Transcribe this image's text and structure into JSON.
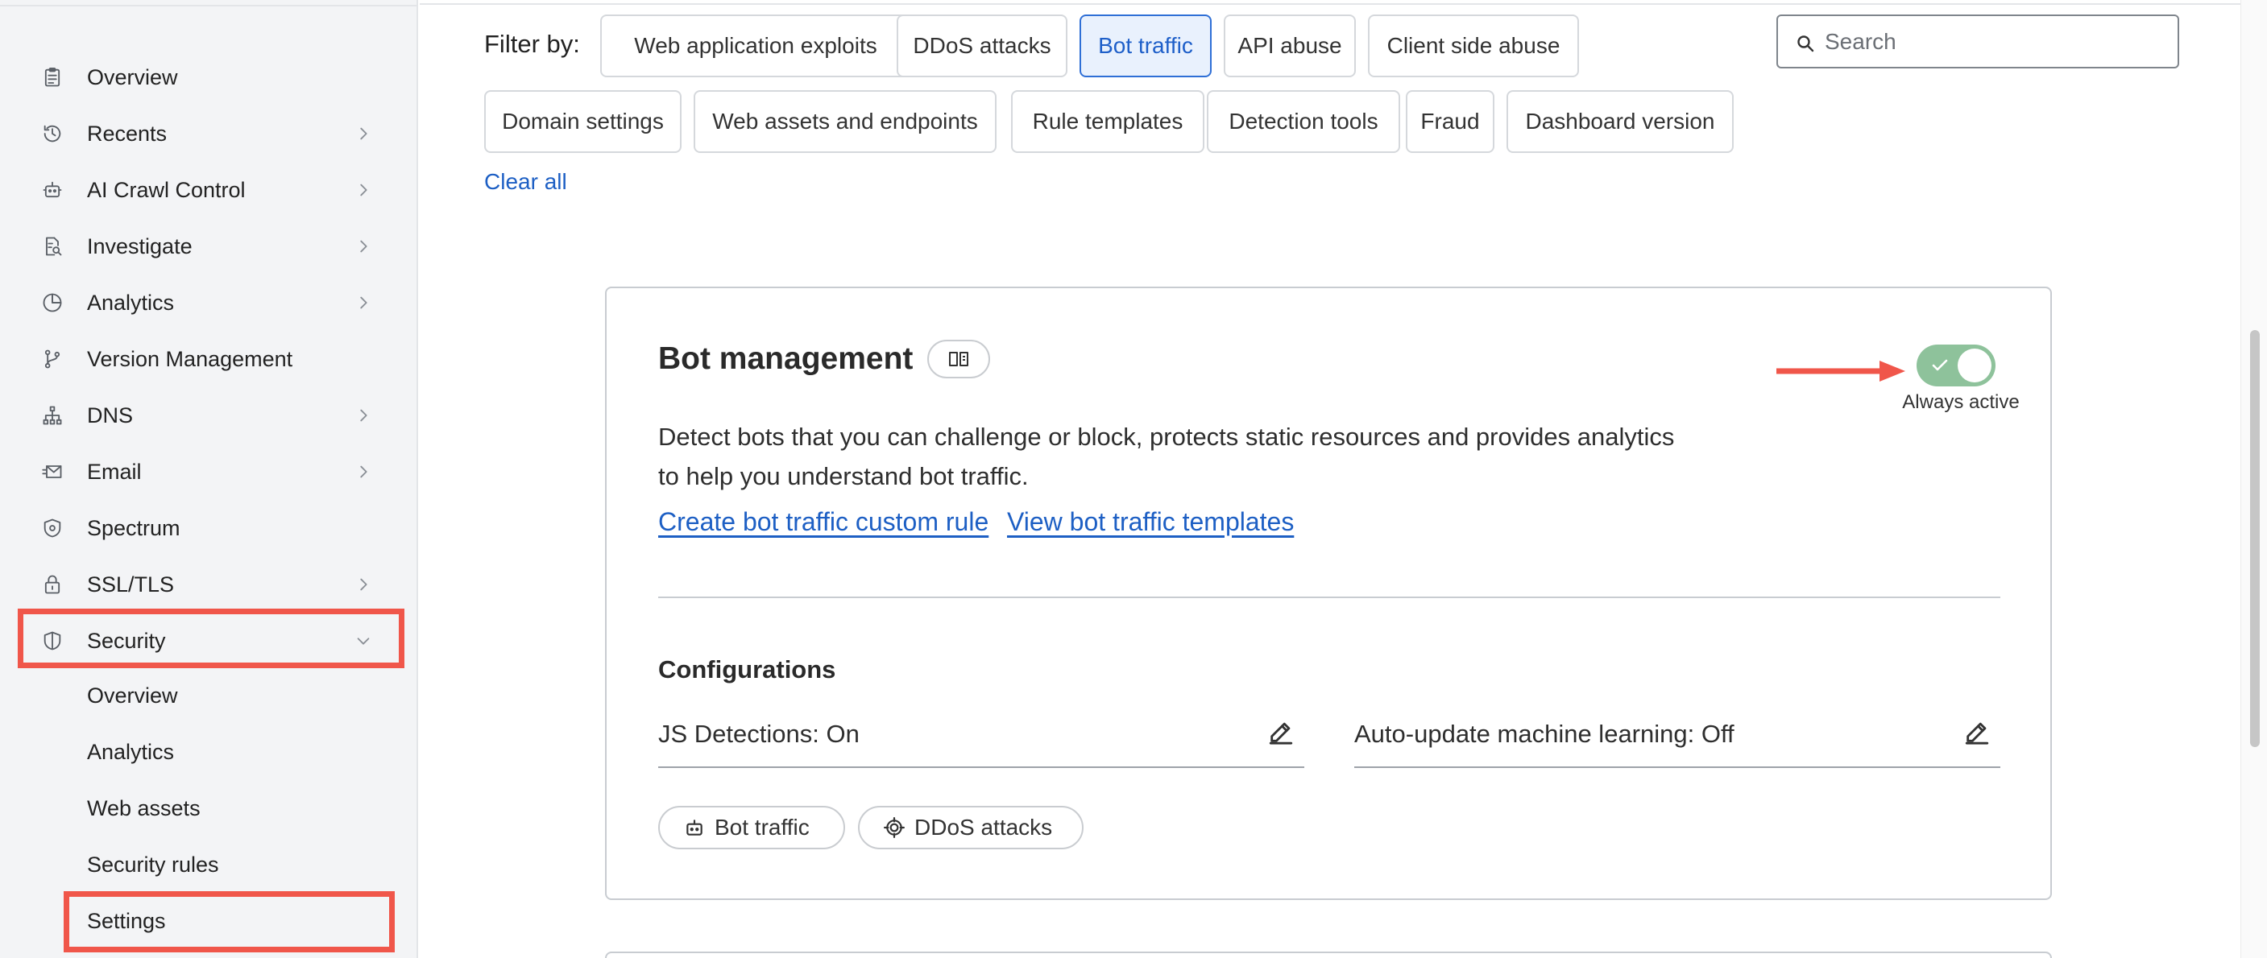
{
  "sidebar": {
    "items": [
      {
        "label": "Overview",
        "icon": "clipboard-icon",
        "chevron": false
      },
      {
        "label": "Recents",
        "icon": "history-icon",
        "chevron": true
      },
      {
        "label": "AI Crawl Control",
        "icon": "robot-icon",
        "chevron": true
      },
      {
        "label": "Investigate",
        "icon": "document-search-icon",
        "chevron": true
      },
      {
        "label": "Analytics",
        "icon": "pie-chart-icon",
        "chevron": true
      },
      {
        "label": "Version Management",
        "icon": "git-branch-icon",
        "chevron": false
      },
      {
        "label": "DNS",
        "icon": "network-icon",
        "chevron": true
      },
      {
        "label": "Email",
        "icon": "envelope-icon",
        "chevron": true
      },
      {
        "label": "Spectrum",
        "icon": "shield-gear-icon",
        "chevron": false
      },
      {
        "label": "SSL/TLS",
        "icon": "lock-icon",
        "chevron": true
      },
      {
        "label": "Security",
        "icon": "shield-icon",
        "chevron": "down",
        "expanded": true
      }
    ],
    "security_sub_items": [
      "Overview",
      "Analytics",
      "Web assets",
      "Security rules",
      "Settings"
    ],
    "active_sub_item": "Settings"
  },
  "filters": {
    "label": "Filter by:",
    "chips": [
      "Web application exploits",
      "DDoS attacks",
      "Bot traffic",
      "API abuse",
      "Client side abuse",
      "Domain settings",
      "Web assets and endpoints",
      "Rule templates",
      "Detection tools",
      "Fraud",
      "Dashboard version"
    ],
    "active_chip": "Bot traffic",
    "clear_all": "Clear all"
  },
  "search": {
    "placeholder": "Search",
    "value": ""
  },
  "card": {
    "title": "Bot management",
    "toggle_label": "Always active",
    "toggle_on": true,
    "description": "Detect bots that you can challenge or block, protects static resources and provides analytics to help you understand bot traffic.",
    "links": [
      "Create bot traffic custom rule",
      "View bot traffic templates"
    ],
    "configurations_title": "Configurations",
    "configurations": [
      "JS Detections: On",
      "Auto-update machine learning: Off"
    ],
    "tags": [
      {
        "label": "Bot traffic",
        "icon": "robot-icon"
      },
      {
        "label": "DDoS attacks",
        "icon": "target-icon"
      }
    ]
  },
  "colors": {
    "accent": "#1d5fc4",
    "highlight": "#f0564a",
    "toggle_on": "#8ec29b"
  }
}
